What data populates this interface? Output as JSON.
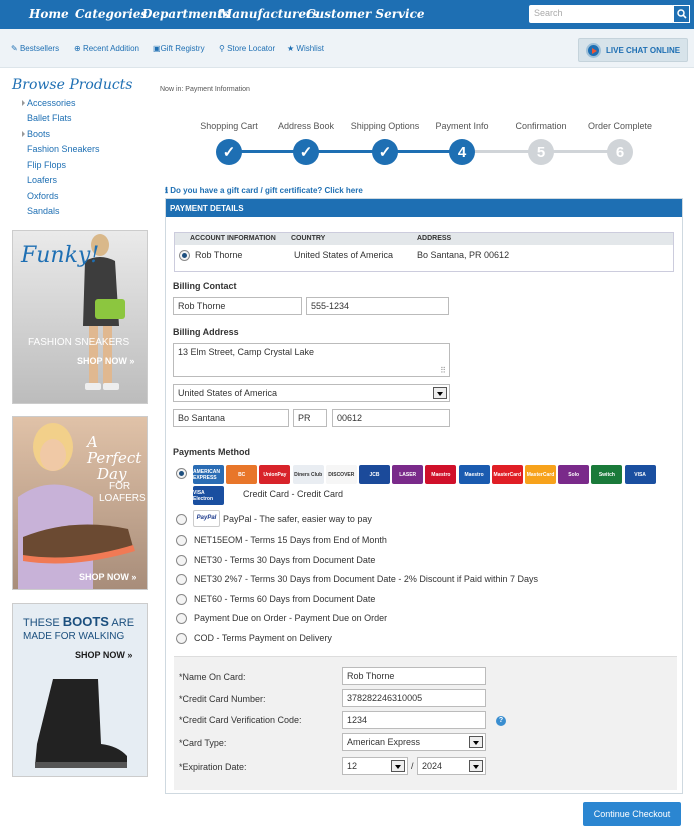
{
  "topnav": {
    "items": [
      "Home",
      "Categories",
      "Departments",
      "Manufacturers",
      "Customer Service"
    ],
    "search_placeholder": "Search"
  },
  "subnav": {
    "items": [
      "Bestsellers",
      "Recent Addition",
      "Gift Registry",
      "Store Locator",
      "Wishlist"
    ],
    "live_chat": "LIVE CHAT ONLINE"
  },
  "sidebar": {
    "title": "Browse Products",
    "categories": [
      "Accessories",
      "Ballet Flats",
      "Boots",
      "Fashion Sneakers",
      "Flip Flops",
      "Loafers",
      "Oxfords",
      "Sandals"
    ]
  },
  "promos": {
    "p1": {
      "headline": "Funky!",
      "sub": "FASHION SNEAKERS",
      "cta": "SHOP NOW »"
    },
    "p2": {
      "headline1": "A",
      "headline2": "Perfect",
      "headline3": "Day",
      "sub1": "FOR",
      "sub2": "LOAFERS",
      "cta": "SHOP NOW »"
    },
    "p3": {
      "line1_pre": "THESE ",
      "line1_bold": "BOOTS",
      "line1_post": " ARE",
      "line2": "MADE FOR WALKING",
      "cta": "SHOP NOW »"
    }
  },
  "breadcrumb": "Now in: Payment Information",
  "steps": [
    {
      "label": "Shopping Cart",
      "mark": "✓",
      "status": "done"
    },
    {
      "label": "Address Book",
      "mark": "✓",
      "status": "done"
    },
    {
      "label": "Shipping Options",
      "mark": "✓",
      "status": "done"
    },
    {
      "label": "Payment Info",
      "mark": "4",
      "status": "current"
    },
    {
      "label": "Confirmation",
      "mark": "5",
      "status": "pending"
    },
    {
      "label": "Order Complete",
      "mark": "6",
      "status": "pending"
    }
  ],
  "gift_link": "Do you have a gift card / gift certificate? Click here",
  "payment": {
    "header": "PAYMENT DETAILS",
    "account_table": {
      "columns": [
        "ACCOUNT INFORMATION",
        "COUNTRY",
        "ADDRESS"
      ],
      "row": [
        "Rob Thorne",
        "United States of America",
        "Bo Santana, PR 00612"
      ]
    },
    "billing_contact": {
      "label": "Billing Contact",
      "name": "Rob Thorne",
      "phone": "555-1234"
    },
    "billing_address": {
      "label": "Billing Address",
      "street": "13 Elm Street, Camp Crystal Lake",
      "country": "United States of America",
      "city": "Bo Santana",
      "state": "PR",
      "zip": "00612"
    },
    "methods_label": "Payments Method",
    "credit_card_label": "Credit Card - Credit Card",
    "paypal_label": "PayPal - The safer, easier way to pay",
    "paypal_logo": "PayPal",
    "methods": [
      "NET15EOM - Terms 15 Days from End of Month",
      "NET30 - Terms 30 Days from Document Date",
      "NET30 2%7 - Terms 30 Days from Document Date - 2% Discount if Paid within 7 Days",
      "NET60 - Terms 60 Days from Document Date",
      "Payment Due on Order - Payment Due on Order",
      "COD - Terms Payment on Delivery"
    ],
    "card_logos": [
      "AMERICAN EXPRESS",
      "BC",
      "UnionPay",
      "Diners Club",
      "DISCOVER",
      "JCB",
      "LASER",
      "Maestro",
      "Maestro",
      "MasterCard",
      "MasterCard",
      "Solo",
      "Switch",
      "VISA",
      "VISA Electron"
    ],
    "cc_form": {
      "name_label": "*Name On Card:",
      "name_value": "Rob Thorne",
      "number_label": "*Credit Card Number:",
      "number_value": "378282246310005",
      "cvc_label": "*Credit Card Verification Code:",
      "cvc_value": "1234",
      "type_label": "*Card Type:",
      "type_value": "American Express",
      "exp_label": "*Expiration Date:",
      "exp_month": "12",
      "exp_sep": "/",
      "exp_year": "2024"
    }
  },
  "continue_label": "Continue Checkout",
  "colors": {
    "brand": "#1e6fb3",
    "pending": "#d0d4d8"
  }
}
